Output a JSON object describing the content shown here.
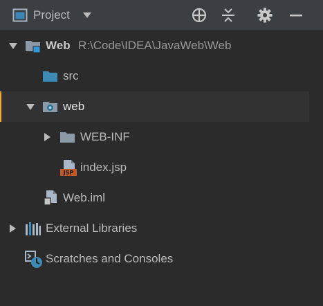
{
  "header": {
    "title": "Project",
    "icons": {
      "project": "project-view-icon",
      "dropdown": "chevron-down-icon",
      "locate": "crosshair-icon",
      "collapse": "collapse-all-icon",
      "settings": "gear-icon",
      "hide": "minimize-icon"
    }
  },
  "tree": {
    "root": {
      "label": "Web",
      "path": "R:\\Code\\IDEA\\JavaWeb\\Web"
    },
    "src": {
      "label": "src"
    },
    "web": {
      "label": "web"
    },
    "webinf": {
      "label": "WEB-INF"
    },
    "indexjsp": {
      "label": "index.jsp",
      "badge": "JSP"
    },
    "webiml": {
      "label": "Web.iml"
    },
    "libraries": {
      "label": "External Libraries"
    },
    "scratches": {
      "label": "Scratches and Consoles"
    }
  },
  "colors": {
    "background": "#2b2b2b",
    "header": "#3c3f41",
    "selection_accent": "#f0a732",
    "folder": "#8c9aa7",
    "source_folder": "#3d8bb4",
    "jsp_badge": "#c2572a"
  }
}
